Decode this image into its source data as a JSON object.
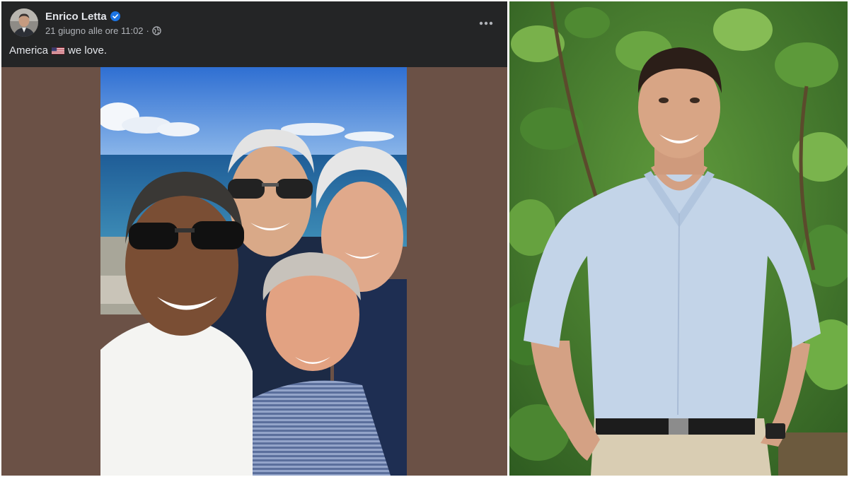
{
  "post": {
    "author_name": "Enrico Letta",
    "verified": true,
    "timestamp": "21 giugno alle ore 11:02",
    "separator": "·",
    "privacy_icon": "globe-icon",
    "more_icon": "more-options-icon",
    "caption_before_flag": "America",
    "caption_flag": "us-flag-emoji",
    "caption_after_flag": "we love."
  },
  "colors": {
    "post_background": "#242526",
    "primary_text": "#e4e6eb",
    "secondary_text": "#b0b3b8",
    "verified_badge": "#1b74e4",
    "media_letterbox": "#6b5146"
  }
}
